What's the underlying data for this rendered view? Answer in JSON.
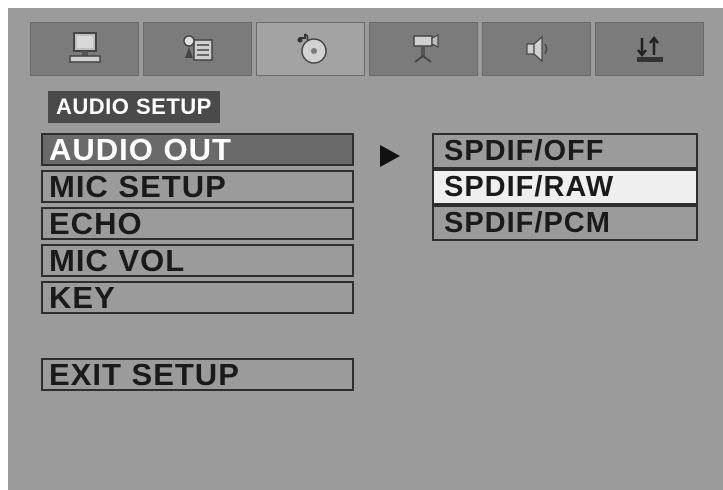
{
  "tabs": [
    {
      "icon": "monitor-icon",
      "active": false
    },
    {
      "icon": "language-settings-icon",
      "active": false
    },
    {
      "icon": "disc-audio-icon",
      "active": true
    },
    {
      "icon": "video-camera-icon",
      "active": false
    },
    {
      "icon": "speaker-icon",
      "active": false
    },
    {
      "icon": "sort-arrows-icon",
      "active": false
    }
  ],
  "section_title": "AUDIO SETUP",
  "menu": {
    "items": [
      {
        "label": "AUDIO OUT",
        "selected": true
      },
      {
        "label": "MIC SETUP",
        "selected": false
      },
      {
        "label": "ECHO",
        "selected": false
      },
      {
        "label": "MIC VOL",
        "selected": false
      },
      {
        "label": "KEY",
        "selected": false
      }
    ],
    "exit_label": "EXIT SETUP"
  },
  "options": {
    "items": [
      {
        "label": "SPDIF/OFF",
        "highlighted": false
      },
      {
        "label": "SPDIF/RAW",
        "highlighted": true
      },
      {
        "label": "SPDIF/PCM",
        "highlighted": false
      }
    ]
  },
  "colors": {
    "background": "#9b9b9b",
    "tab": "#7b7b7b",
    "tab_active": "#a3a3a3",
    "selected_item": "#6a6a6a",
    "highlighted_option": "#efefef",
    "title_bg": "#4a4a4a"
  }
}
